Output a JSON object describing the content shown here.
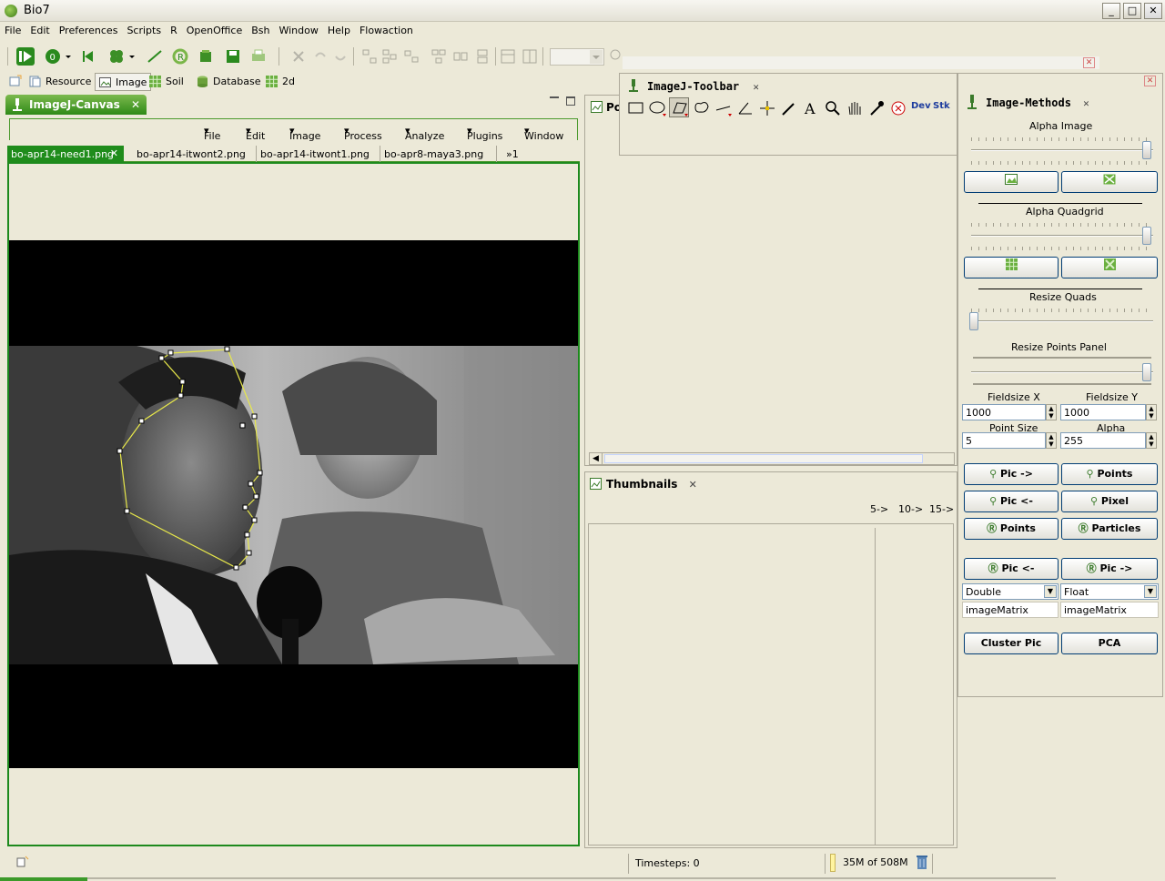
{
  "window": {
    "title": "Bio7",
    "min": "_",
    "max": "□",
    "close": "✕"
  },
  "menubar": [
    "File",
    "Edit",
    "Preferences",
    "Scripts",
    "R",
    "OpenOffice",
    "Bsh",
    "Window",
    "Help",
    "Flowaction"
  ],
  "perspectives": [
    {
      "label": "Resource",
      "icon": "resource-icon",
      "selected": false
    },
    {
      "label": "Image",
      "icon": "image-icon",
      "selected": true
    },
    {
      "label": "Soil",
      "icon": "grid-icon",
      "selected": false
    },
    {
      "label": "Database",
      "icon": "database-icon",
      "selected": false
    },
    {
      "label": "2d",
      "icon": "grid-icon",
      "selected": false
    }
  ],
  "canvas": {
    "tab_label": "ImageJ-Canvas",
    "menu": [
      "File",
      "Edit",
      "Image",
      "Process",
      "Analyze",
      "Plugins",
      "Window"
    ],
    "image_tabs": [
      "bo-apr14-need1.png",
      "bo-apr14-itwont2.png",
      "bo-apr14-itwont1.png",
      "bo-apr8-maya3.png"
    ],
    "more_tabs": "»1"
  },
  "po_view": {
    "tab_label": "Po"
  },
  "thumbnails": {
    "tab_label": "Thumbnails",
    "nav": [
      "5->",
      "10->",
      "15->"
    ]
  },
  "ij_toolbar": {
    "tab_label": "ImageJ-Toolbar",
    "dev_label": "Dev",
    "stk_label": "Stk"
  },
  "image_methods": {
    "tab_label": "Image-Methods",
    "alpha_image_label": "Alpha Image",
    "alpha_quadgrid_label": "Alpha Quadgrid",
    "resize_quads_label": "Resize Quads",
    "resize_points_label": "Resize Points Panel",
    "fieldsize_x_label": "Fieldsize X",
    "fieldsize_y_label": "Fieldsize Y",
    "fieldsize_x": "1000",
    "fieldsize_y": "1000",
    "point_size_label": "Point Size",
    "alpha_label": "Alpha",
    "point_size": "5",
    "alpha": "255",
    "buttons": {
      "pic_to": "Pic ->",
      "points": "Points",
      "pic_from": "Pic <-",
      "pixel": "Pixel",
      "r_points": "Points",
      "particles": "Particles",
      "r_pic_from": "Pic <-",
      "r_pic_to": "Pic ->",
      "cluster_pic": "Cluster Pic",
      "pca": "PCA"
    },
    "type_left": "Double",
    "type_right": "Float",
    "matrix_left": "imageMatrix",
    "matrix_right": "imageMatrix"
  },
  "status": {
    "timesteps": "Timesteps: 0",
    "memory": "35M of 508M"
  },
  "colors": {
    "accent_green": "#1D8A1D",
    "selection_yellow": "#E8E84A"
  }
}
